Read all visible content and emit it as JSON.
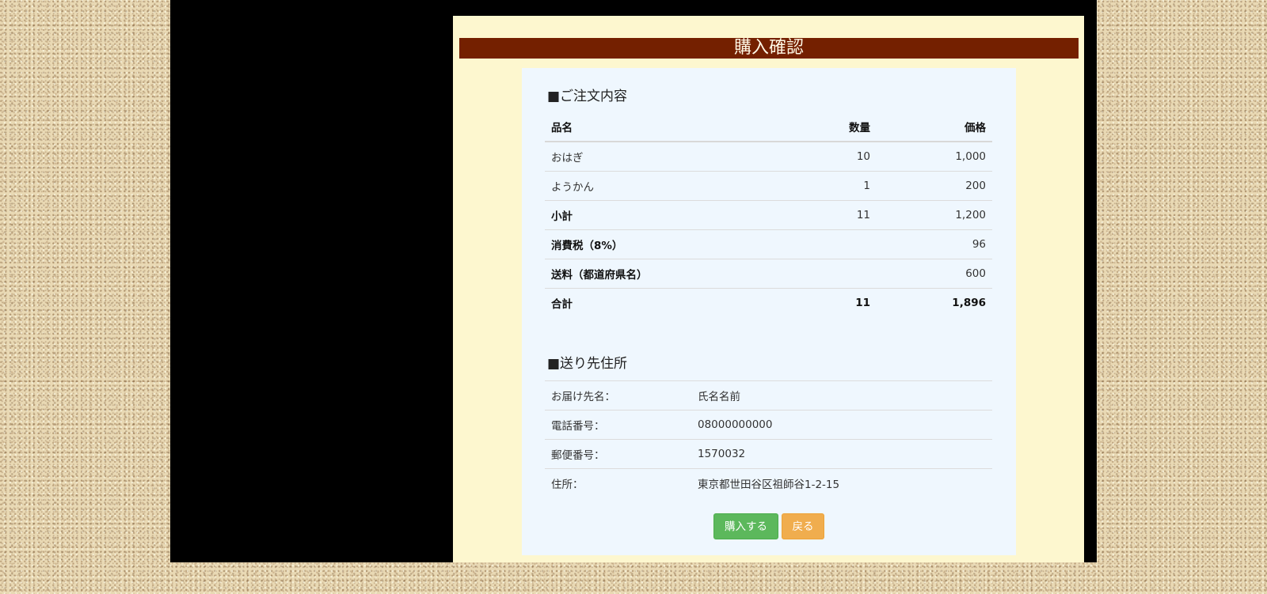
{
  "page": {
    "title": "購入確認"
  },
  "order": {
    "heading": "■ご注文内容",
    "columns": {
      "name": "品名",
      "qty": "数量",
      "price": "価格"
    },
    "items": [
      {
        "name": "おはぎ",
        "qty": "10",
        "price": "1,000"
      },
      {
        "name": "ようかん",
        "qty": "1",
        "price": "200"
      }
    ],
    "subtotal": {
      "label": "小計",
      "qty": "11",
      "price": "1,200"
    },
    "tax": {
      "label": "消費税（8%）",
      "qty": "",
      "price": "96"
    },
    "shipping": {
      "label": "送料（都道府県名）",
      "qty": "",
      "price": "600"
    },
    "total": {
      "label": "合計",
      "qty": "11",
      "price": "1,896"
    }
  },
  "address": {
    "heading": "■送り先住所",
    "rows": [
      {
        "label": "お届け先名：",
        "value": "氏名名前"
      },
      {
        "label": "電話番号：",
        "value": "08000000000"
      },
      {
        "label": "郵便番号：",
        "value": "1570032"
      },
      {
        "label": "住所：",
        "value": "東京都世田谷区祖師谷1-2-15"
      }
    ]
  },
  "actions": {
    "buy_label": "購入する",
    "back_label": "戻る"
  },
  "colors": {
    "title_bar": "#742000",
    "panel": "#fdf7cf",
    "card": "#eff7fe",
    "buy_button": "#5cb85c",
    "back_button": "#f0ad4e"
  }
}
